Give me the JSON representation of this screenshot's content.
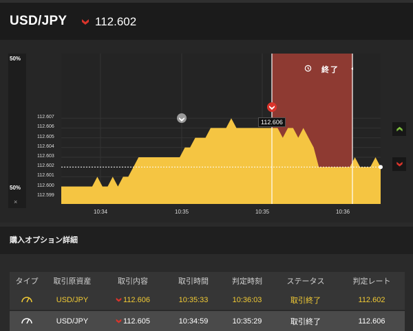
{
  "header": {
    "pair": "USD/JPY",
    "price": "112.602",
    "direction": "down",
    "arrow_color": "#d9342b"
  },
  "sentiment": {
    "top_label": "50%",
    "bottom_label": "50%",
    "close": "×",
    "up_color": "#7fbf3f",
    "down_color": "#e0572b"
  },
  "chart": {
    "end_label": "終了",
    "price_tag": "112.606",
    "fill_color": "#f5c542",
    "expiry_zone_color": "#8e3a32",
    "y_ticks": [
      "112.607",
      "112.606",
      "112.605",
      "112.604",
      "112.603",
      "112.602",
      "112.601",
      "112.600",
      "112.599"
    ],
    "x_ticks": [
      "10:34",
      "10:35",
      "10:35",
      "10:36"
    ]
  },
  "chart_data": {
    "type": "area",
    "series": [
      {
        "values": [
          112.6,
          112.6,
          112.6,
          112.6,
          112.6,
          112.6,
          112.6,
          112.601,
          112.6,
          112.6,
          112.601,
          112.6,
          112.601,
          112.601,
          112.602,
          112.603,
          112.603,
          112.603,
          112.603,
          112.603,
          112.603,
          112.603,
          112.603,
          112.603,
          112.604,
          112.604,
          112.605,
          112.605,
          112.605,
          112.606,
          112.606,
          112.606,
          112.606,
          112.607,
          112.606,
          112.606,
          112.606,
          112.606,
          112.606,
          112.606,
          112.606,
          112.606,
          112.606,
          112.605,
          112.606,
          112.606,
          112.605,
          112.606,
          112.605,
          112.604,
          112.602,
          112.602,
          112.602,
          112.602,
          112.602,
          112.602,
          112.602,
          112.603,
          112.602,
          112.602,
          112.602,
          112.603,
          112.602
        ]
      }
    ],
    "ylim": [
      112.598,
      112.608
    ],
    "grid": true
  },
  "section": {
    "title": "購入オプション詳細"
  },
  "table": {
    "headers": [
      "タイプ",
      "取引原資産",
      "取引内容",
      "取引時間",
      "判定時刻",
      "ステータス",
      "判定レート"
    ],
    "rows": [
      {
        "asset": "USD/JPY",
        "content": "112.606",
        "time": "10:35:33",
        "judge_time": "10:36:03",
        "status": "取引終了",
        "rate": "112.602"
      },
      {
        "asset": "USD/JPY",
        "content": "112.605",
        "time": "10:34:59",
        "judge_time": "10:35:29",
        "status": "取引終了",
        "rate": "112.606"
      }
    ]
  }
}
